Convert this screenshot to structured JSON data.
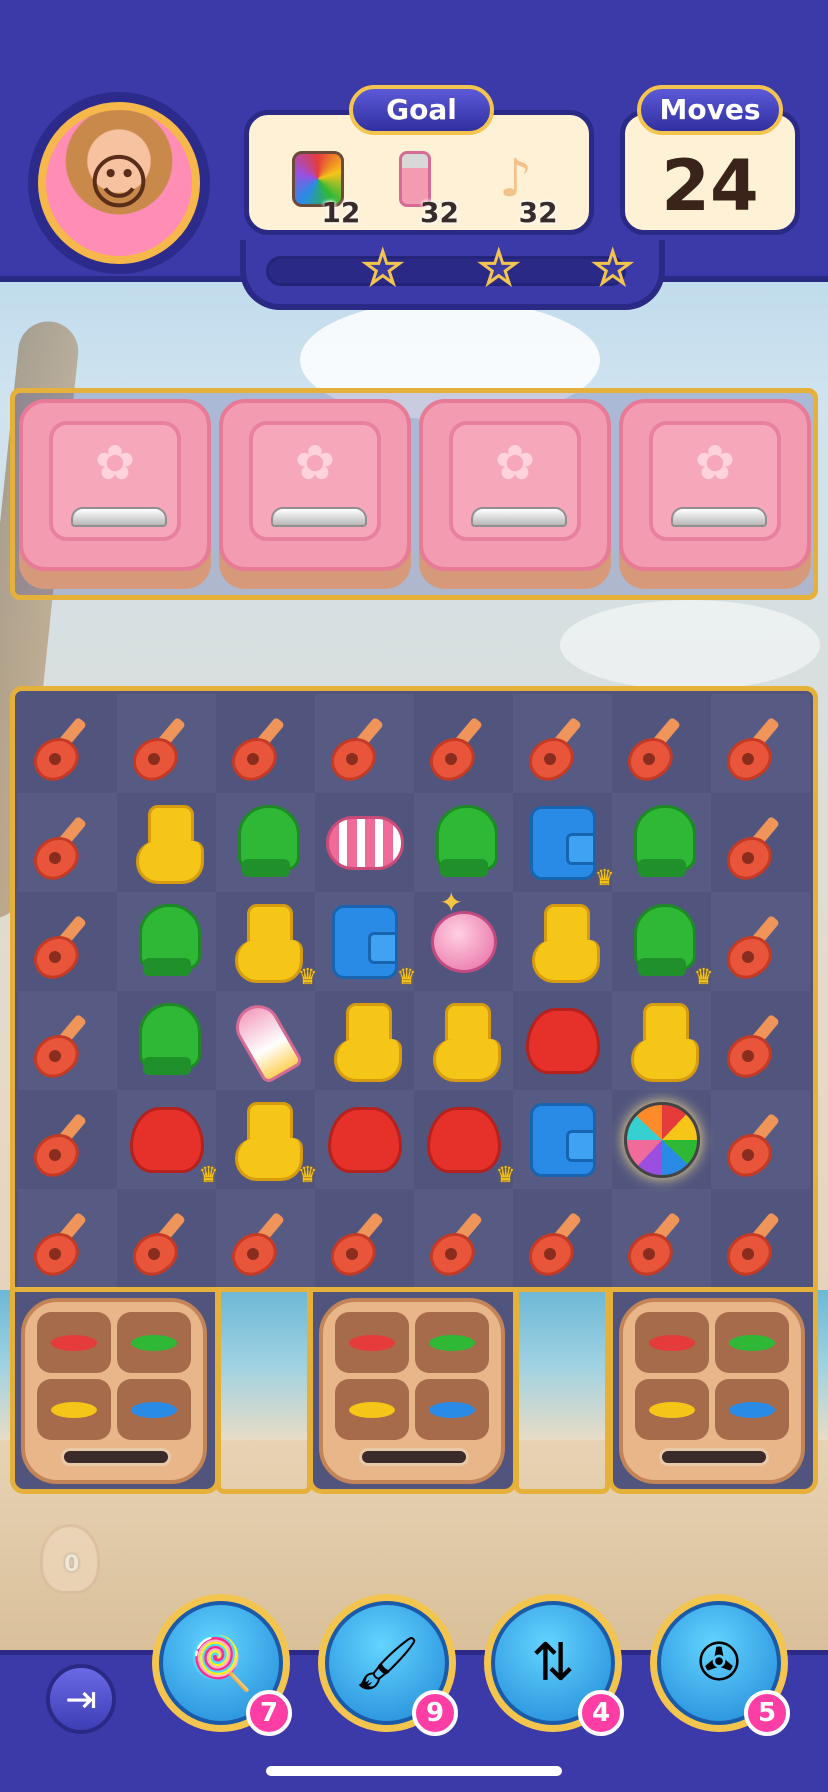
{
  "header": {
    "goal_title": "Goal",
    "moves_title": "Moves",
    "moves_value": "24",
    "goals": [
      {
        "icon": "color-palette-icon",
        "count": "12",
        "color": "#e8553a"
      },
      {
        "icon": "nail-polish-icon",
        "count": "32",
        "color": "#f39bb0"
      },
      {
        "icon": "music-note-icon",
        "count": "32",
        "color": "#f5c518"
      }
    ],
    "progress": 0.0,
    "stars": 3
  },
  "top_blocks": {
    "count": 4,
    "icon": "rose-icon",
    "handle": "handle-icon"
  },
  "board": {
    "rows": [
      [
        "guitar",
        "guitar",
        "guitar",
        "guitar",
        "guitar",
        "guitar",
        "guitar",
        "guitar"
      ],
      [
        "guitar",
        "boot",
        "mitten",
        "candy",
        "mitten",
        "wallet*",
        "mitten",
        "guitar"
      ],
      [
        "guitar",
        "mitten",
        "boot*",
        "wallet*",
        "bomb",
        "boot",
        "mitten*",
        "guitar"
      ],
      [
        "guitar",
        "mitten",
        "rocket",
        "boot",
        "boot",
        "bag",
        "boot",
        "guitar"
      ],
      [
        "guitar",
        "bag*",
        "boot*",
        "bag",
        "bag*",
        "wallet",
        "disco",
        "guitar"
      ],
      [
        "guitar",
        "guitar",
        "guitar",
        "guitar",
        "guitar",
        "guitar",
        "guitar",
        "guitar"
      ]
    ],
    "palette_colors": [
      "#e63b3b",
      "#2fb836",
      "#f5c518",
      "#2a8be6"
    ]
  },
  "helper": {
    "count": "0"
  },
  "boosters": [
    {
      "name": "lollipop-hammer-icon",
      "count": "7"
    },
    {
      "name": "makeup-brush-icon",
      "count": "9"
    },
    {
      "name": "hair-brush-icon",
      "count": "4"
    },
    {
      "name": "fan-shuffle-icon",
      "count": "5"
    }
  ]
}
